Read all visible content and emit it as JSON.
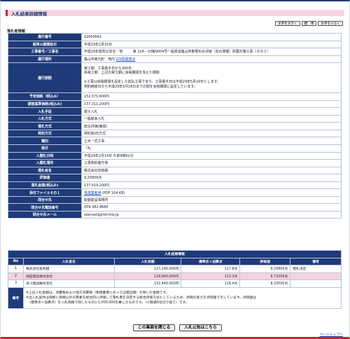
{
  "page_title": "入札結果詳細情報",
  "font_size_buttons": [
    "文字を大きく",
    "標　準",
    "文字を小さく"
  ],
  "section_label": "落札者情報",
  "info_rows": [
    {
      "label": "施行番号",
      "value": "42005642"
    },
    {
      "label": "結果公開開始日",
      "value": "平成29年2月15日"
    },
    {
      "label": "工事番号／工事名",
      "value": "平成28年度防災安全・他　　　第 22A－33第0004号一般県道亀山停車場石水渓線（池の側橋）耐震対策工事（その２）"
    },
    {
      "label": "履行場所",
      "value": "亀山市東丸町　地内",
      "link": "GIS情報表示"
    },
    {
      "label": "履行期間",
      "lines": [
        "実工期：工事着手日から300日",
        "余裕工期：上記の実工期に余裕期間を加えた期間",
        "",
        "※工事は余裕期間を設定した前払工事であり、工事着手日は平成29年5月19日とします。",
        "契約締結日から平成29年5月18日までの間を余裕期間に設定しています。"
      ]
    },
    {
      "label": "予定価格（税込み）",
      "value": "152,571,600円"
    },
    {
      "label": "調査基準価格(税込み)",
      "value": "137,311,200円"
    },
    {
      "label": "入札手段",
      "value": "電子入札"
    },
    {
      "label": "入札方式",
      "value": "一般競争入札"
    },
    {
      "label": "落札方式",
      "value": "総合評価(簡易)"
    },
    {
      "label": "契約方式",
      "value": "契約後VE方式"
    },
    {
      "label": "種別",
      "value": "土木一式工事"
    },
    {
      "label": "格付",
      "value": "「A」"
    },
    {
      "label": "入開札日時",
      "value": "平成29年2月14日 午前9時02分"
    },
    {
      "label": "入開札場所",
      "value": "三重県鈴鹿庁舎"
    },
    {
      "label": "落札者名",
      "value": "株式会社松和組"
    },
    {
      "label": "評価値",
      "value": "9.25809点"
    },
    {
      "label": "落札金額(税込み)",
      "value": "137,419,200円"
    },
    {
      "label": "添付ファイルその１",
      "link": "落選業者通",
      "suffix": "(PDF 104 KB)"
    },
    {
      "label": "問合せ先",
      "value": "鈴鹿建設事務所"
    },
    {
      "label": "問合せ先電話番号",
      "value": "059-382-8680"
    },
    {
      "label": "問合せ先メール",
      "value": "skenset@pref.mie.jp"
    }
  ],
  "results": {
    "title": "入札結果情報",
    "headers": [
      "No",
      "入札者名",
      "入札金額",
      "標準点＋加算点",
      "評価値",
      "備考"
    ],
    "rows": [
      {
        "no": "1",
        "name": "株式会社松和組",
        "amount": "127,240,000円",
        "score": "117.8点",
        "eval": "9.25809点",
        "note": "落札決定"
      },
      {
        "no": "2",
        "name": "協田建設株式会社",
        "amount": "129,900,000円",
        "score": "113.3点",
        "eval": "8.72209点",
        "note": ""
      },
      {
        "no": "3",
        "name": "日川建設株式会社",
        "amount": "132,440,000円",
        "score": "116.4点",
        "eval": "8.33505点",
        "note": ""
      }
    ],
    "note_label": "備考",
    "note_lines": [
      "※上記入札金額は、消費税および地方消費税（免税業者にあっては相当額）を除いた金額です。",
      "※当入札案件は価格と価格以外の要素を総合的に評価して落札者を決定する総合評価方式としているため、評価の高さを評価値で示しています。評価値は",
      "　（標準点＋加算点）を入札価格で除したものに1,000,000を乗じたものです。（小数第6位切り捨て）です。"
    ]
  },
  "bottom_buttons": [
    "この画面を閉じる",
    "入札公告はこちら"
  ],
  "page_top_link": "ページトップへ"
}
